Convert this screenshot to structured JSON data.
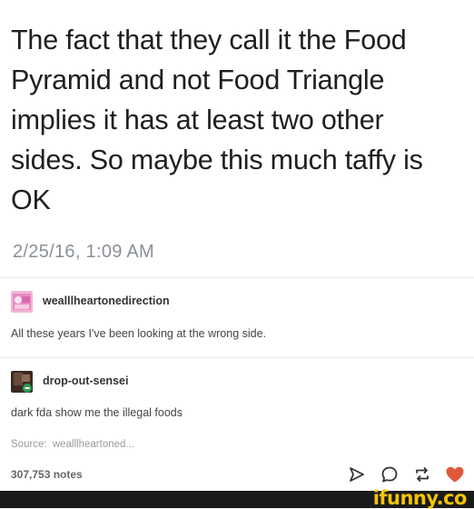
{
  "tweet": {
    "text": "The fact that they call it the Food\nPyramid and not Food Triangle\nimplies it has at least two other\nsides.  So maybe this much taffy is\nOK",
    "timestamp": "2/25/16, 1:09 AM"
  },
  "reblogs": [
    {
      "username": "wealllheartonedirection",
      "text": "All these years I've been looking at the wrong side."
    },
    {
      "username": "drop-out-sensei",
      "text": "dark fda show me the illegal foods"
    }
  ],
  "source": {
    "label": "Source:",
    "value": "wealllheartoned..."
  },
  "notes": "307,753 notes",
  "actions": {
    "share_icon": "send-icon",
    "reply_icon": "reply-bubble-icon",
    "reblog_icon": "reblog-icon",
    "like_icon": "heart-icon",
    "like_color": "#e0573c",
    "icon_color": "#333333"
  },
  "watermark": "ifunny.co",
  "watermark_color": "#f5c400"
}
